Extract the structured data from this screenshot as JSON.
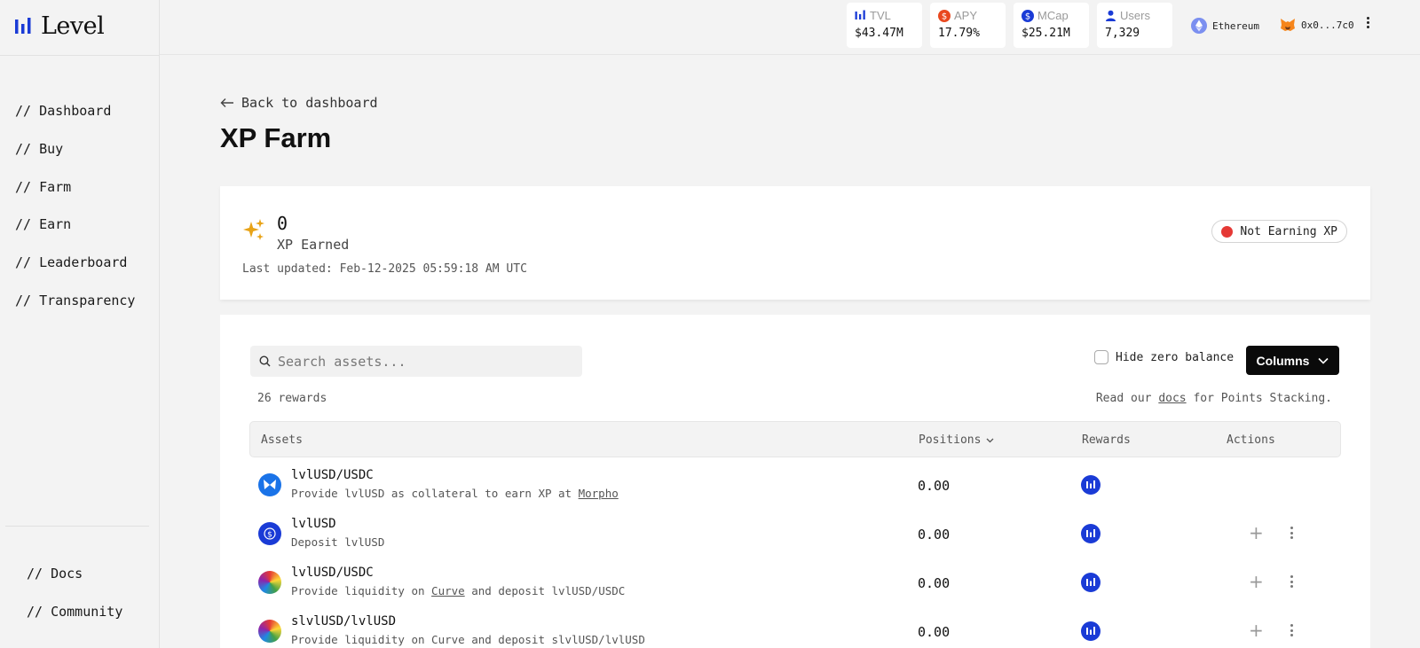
{
  "app": {
    "logo_text": "Level"
  },
  "sidebar": {
    "items": [
      {
        "label": "// Dashboard"
      },
      {
        "label": "// Buy"
      },
      {
        "label": "// Farm"
      },
      {
        "label": "// Earn"
      },
      {
        "label": "// Leaderboard"
      },
      {
        "label": "// Transparency"
      }
    ],
    "bottom_items": [
      {
        "label": "// Docs"
      },
      {
        "label": "// Community"
      }
    ]
  },
  "header": {
    "stats": [
      {
        "label": "TVL",
        "value": "$43.47M",
        "icon": "level-bars-icon"
      },
      {
        "label": "APY",
        "value": "17.79%",
        "icon": "dollar-circle-icon",
        "color": "#e9481f"
      },
      {
        "label": "MCap",
        "value": "$25.21M",
        "icon": "dollar-circle-icon",
        "color": "#1a3bd6"
      },
      {
        "label": "Users",
        "value": "7,329",
        "icon": "user-icon",
        "color": "#1a3bd6"
      }
    ],
    "network": "Ethereum",
    "wallet": "0x0...7c0"
  },
  "main": {
    "back_label": "Back to dashboard",
    "title": "XP Farm",
    "xp": {
      "value": "0",
      "label": "XP Earned",
      "updated": "Last updated: Feb-12-2025 05:59:18 AM UTC",
      "status": "Not Earning XP"
    },
    "table": {
      "search_placeholder": "Search assets...",
      "hide_zero_label": "Hide zero balance",
      "columns_label": "Columns",
      "rewards_count": "26 rewards",
      "docs_note_pre": "Read our ",
      "docs_link": "docs",
      "docs_note_post": " for Points Stacking.",
      "headers": {
        "assets": "Assets",
        "positions": "Positions",
        "rewards": "Rewards",
        "actions": "Actions"
      },
      "rows": [
        {
          "name": "lvlUSD/USDC",
          "desc": "Provide lvlUSD as collateral to earn XP at ",
          "link": "Morpho",
          "desc_post": "",
          "position": "0.00"
        },
        {
          "name": "lvlUSD",
          "desc": "Deposit lvlUSD",
          "link": "",
          "desc_post": "",
          "position": "0.00"
        },
        {
          "name": "lvlUSD/USDC",
          "desc": "Provide liquidity on ",
          "link": "Curve",
          "desc_post": " and deposit lvlUSD/USDC",
          "position": "0.00"
        },
        {
          "name": "slvlUSD/lvlUSD",
          "desc": "Provide liquidity on Curve and deposit slvlUSD/lvlUSD",
          "link": "",
          "desc_post": "",
          "position": "0.00"
        }
      ]
    }
  },
  "colors": {
    "accent": "#1a3bd6",
    "status_red": "#e53935",
    "xp_gold": "#e8a317"
  }
}
